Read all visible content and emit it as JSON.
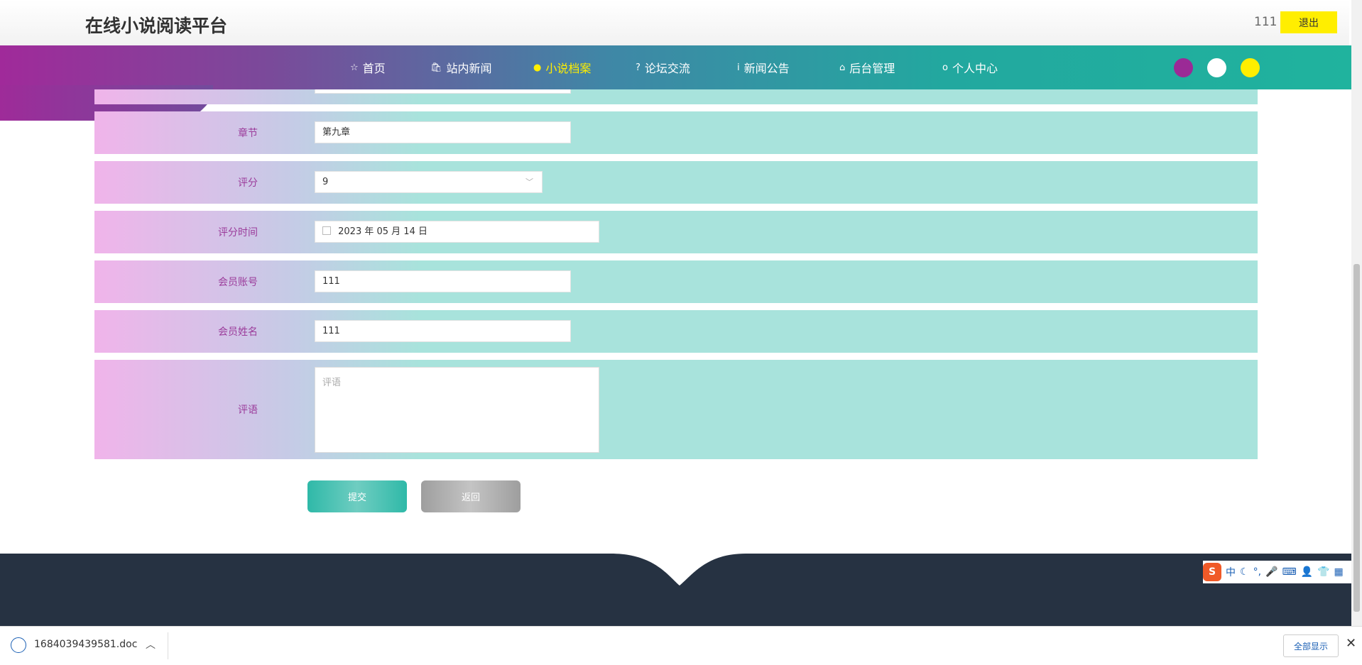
{
  "header": {
    "site_title": "在线小说阅读平台",
    "user_name": "111",
    "logout_label": "退出"
  },
  "nav": {
    "items": [
      {
        "label": "首页",
        "icon": "☆"
      },
      {
        "label": "站内新闻",
        "icon": "🛍"
      },
      {
        "label": "小说档案",
        "icon": "●"
      },
      {
        "label": "论坛交流",
        "icon": "?"
      },
      {
        "label": "新闻公告",
        "icon": "i"
      },
      {
        "label": "后台管理",
        "icon": "⌂"
      },
      {
        "label": "个人中心",
        "icon": "ο"
      }
    ],
    "active_label": "小说档案",
    "theme_colors": [
      "#9b2a96",
      "#ffffff",
      "#ffee00"
    ]
  },
  "form": {
    "chapter_label": "章节",
    "chapter_value": "第九章",
    "rating_label": "评分",
    "rating_value": "9",
    "rating_time_label": "评分时间",
    "rating_time_value": "2023 年 05 月 14 日",
    "member_account_label": "会员账号",
    "member_account_value": "111",
    "member_name_label": "会员姓名",
    "member_name_value": "111",
    "comment_label": "评语",
    "comment_placeholder": "评语",
    "submit_label": "提交",
    "back_label": "返回"
  },
  "download_bar": {
    "file_name": "1684039439581.doc",
    "show_all_label": "全部显示"
  },
  "colors": {
    "accent": "#20b39e",
    "highlight": "#ffee00",
    "footer": "#263242"
  }
}
